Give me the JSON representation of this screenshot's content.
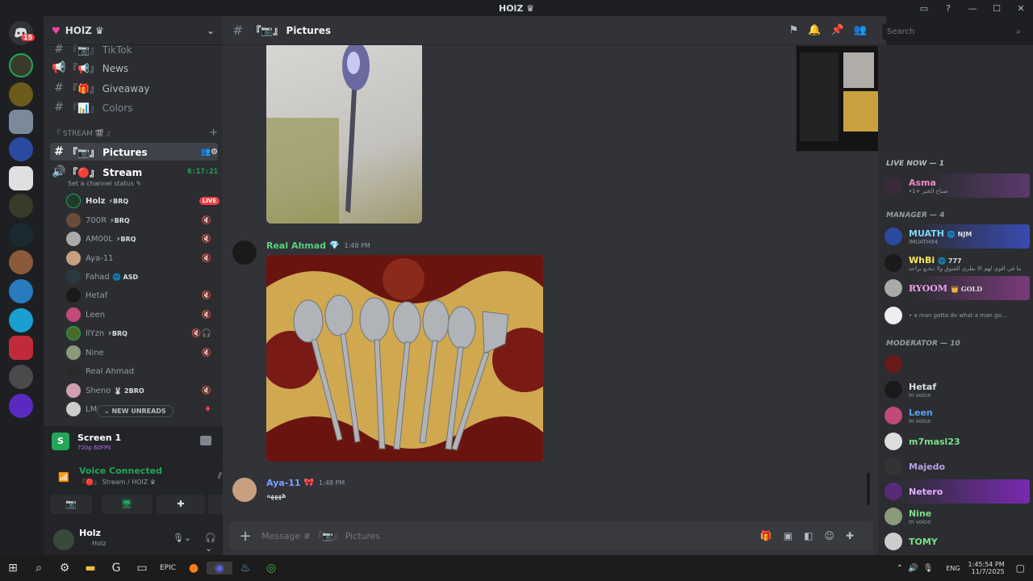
{
  "window": {
    "title": "HOlZ ♛",
    "controls": [
      "▭",
      "?",
      "—",
      "☐",
      "✕"
    ]
  },
  "servers": {
    "home_badge": "15"
  },
  "guild": {
    "name": "HOlZ ♛",
    "chevron": "⌄"
  },
  "channels": [
    {
      "icon": "#",
      "label": "『📷』 TikTok"
    },
    {
      "icon": "📢",
      "label": "『📢』 News"
    },
    {
      "icon": "#",
      "label": "『🎁』 Giveaway"
    },
    {
      "icon": "#",
      "label": "『📊』 Colors"
    }
  ],
  "category": {
    "label": "『 STREAM 🎬 』",
    "add": "+"
  },
  "active_channel": {
    "label": "『📷』 Pictures"
  },
  "stream_channel": {
    "label": "『🔴』 Stream",
    "timer": "6:17:21",
    "status": "Set a channel status ✎"
  },
  "voice_users": [
    {
      "name": "Holz",
      "tag": "⚡BRQ",
      "live": "LIVE"
    },
    {
      "name": "700R",
      "tag": "⚡BRQ"
    },
    {
      "name": "AM00L",
      "tag": "⚡BRQ"
    },
    {
      "name": "Aya-11",
      "tag": ""
    },
    {
      "name": "Fahad",
      "tag": "🌐 ASD"
    },
    {
      "name": "Hetaf",
      "tag": ""
    },
    {
      "name": "Leen",
      "tag": ""
    },
    {
      "name": "llYzn",
      "tag": "⚡BRQ"
    },
    {
      "name": "Nine",
      "tag": ""
    },
    {
      "name": "Real Ahmad",
      "tag": ""
    },
    {
      "name": "Sheno",
      "tag": "🐰 2BRO"
    },
    {
      "name": "LM",
      "tag": ""
    }
  ],
  "new_unreads": "⌄  NEW UNREADS",
  "screen_share": {
    "title": "Screen 1",
    "sub": "720p 60FPS"
  },
  "voice": {
    "status": "Voice Connected",
    "channel": "『🔴』 Stream / HOlZ ♛"
  },
  "user_panel": {
    "name": "Holz",
    "sub": "Holz"
  },
  "chat_header": {
    "hash": "#",
    "name": "『📷』 Pictures",
    "search_placeholder": "Search"
  },
  "messages": [
    {
      "author": "Real Ahmad",
      "badge": "💎",
      "time": "1:48 PM"
    },
    {
      "author": "Aya-11",
      "badge": "🎀",
      "time": "1:48 PM",
      "text": "ههههه"
    }
  ],
  "composer": {
    "placeholder": "Message # 『📷』 Pictures",
    "plus": "+"
  },
  "members": {
    "sections": [
      {
        "label": "LIVE NOW — 1"
      },
      {
        "label": "MANAGER — 4"
      },
      {
        "label": "MODERATOR — 10"
      }
    ],
    "live": [
      {
        "name": "Asma",
        "sub": "•1+ صباح الخير"
      }
    ],
    "managers": [
      {
        "name": "MUATH",
        "tag": "🌐 NJM",
        "sub": "IMUATH94"
      },
      {
        "name": "WhBi",
        "tag": "🌐 777",
        "sub": "ما في أقوى لهم الا بطرى الشوق ولا نـخـع براحه"
      },
      {
        "name": "RYOOM",
        "tag": "👑 GOLD",
        "sub": ""
      },
      {
        "name": "",
        "tag": "",
        "sub": "• a man gotta do what a man go..."
      }
    ],
    "mods": [
      {
        "name": "",
        "sub": ""
      },
      {
        "name": "Hetaf",
        "sub": "In voice"
      },
      {
        "name": "Leen",
        "sub": "In voice"
      },
      {
        "name": "m7masl23",
        "sub": ""
      },
      {
        "name": "Majedo",
        "sub": ""
      },
      {
        "name": "Netero",
        "sub": ""
      },
      {
        "name": "Nine",
        "sub": "In voice"
      },
      {
        "name": "TOMY",
        "sub": ""
      }
    ]
  },
  "taskbar": {
    "lang": "ENG",
    "time": "1:45:54 PM",
    "date": "11/7/2025"
  },
  "colors": {
    "accent": "#5865f2",
    "green": "#23a55a",
    "red": "#f23f43",
    "live": "#f23f43"
  }
}
